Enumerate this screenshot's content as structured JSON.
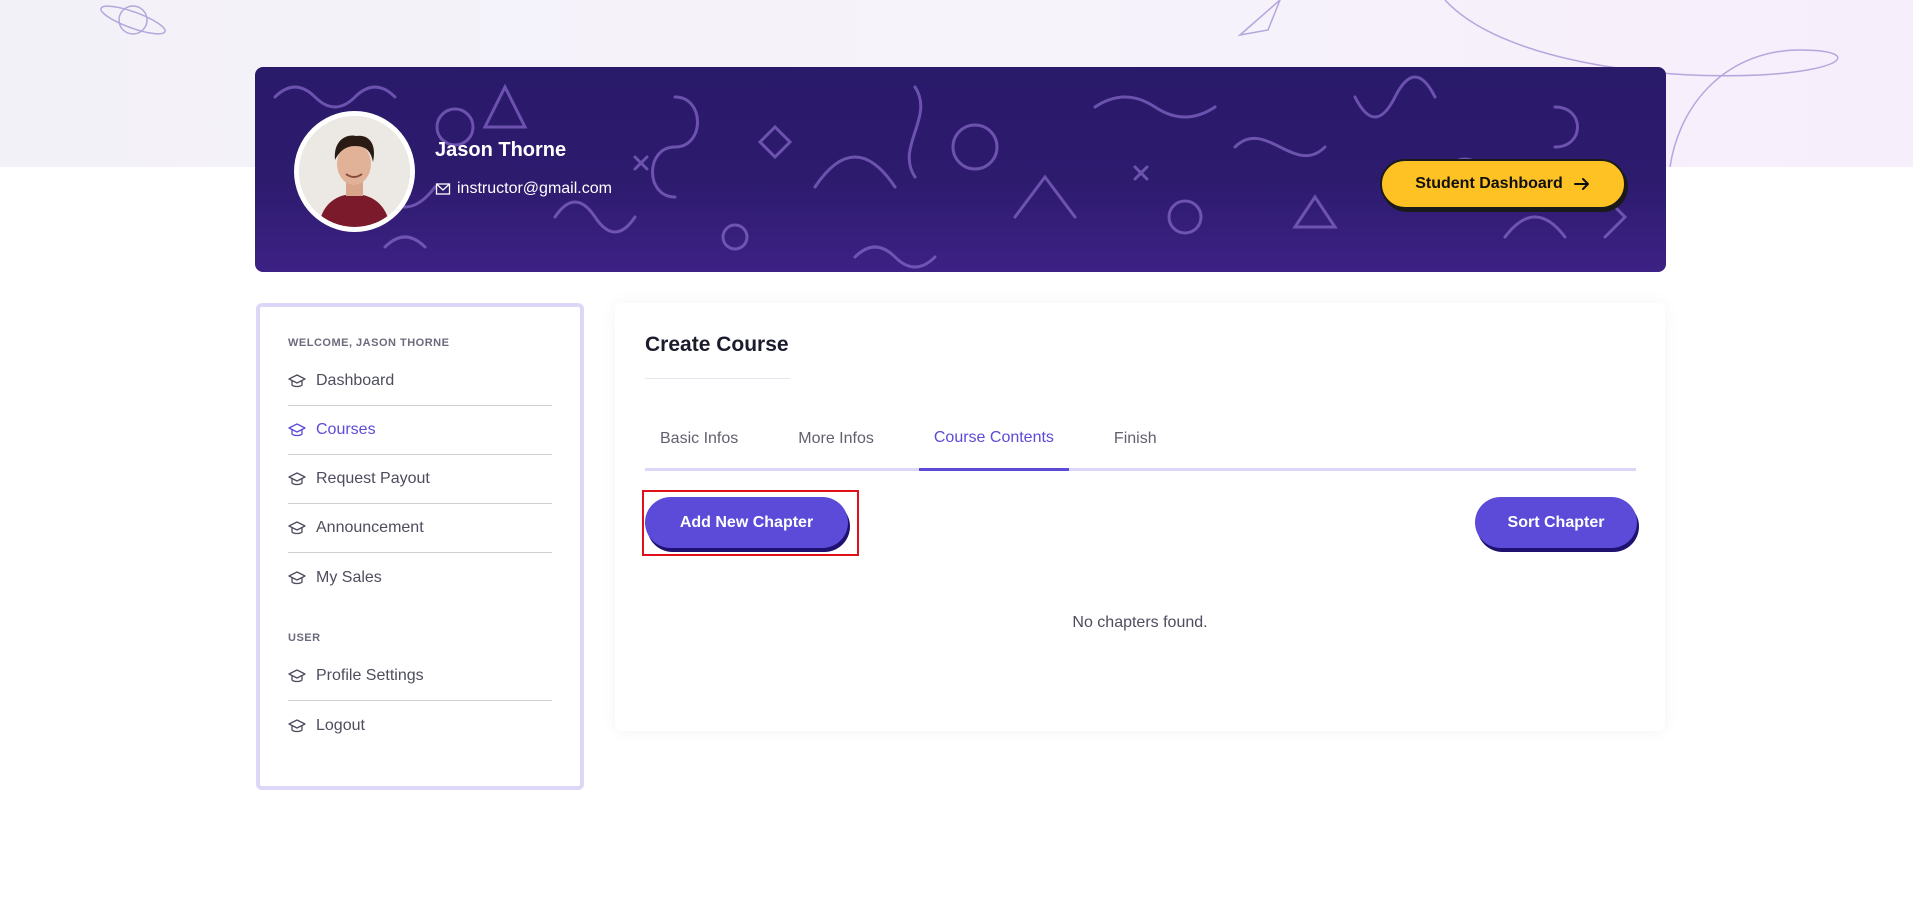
{
  "profile": {
    "name": "Jason Thorne",
    "email": "instructor@gmail.com",
    "student_dashboard_label": "Student Dashboard"
  },
  "sidebar": {
    "welcome_label": "WELCOME, JASON THORNE",
    "items": [
      {
        "label": "Dashboard"
      },
      {
        "label": "Courses"
      },
      {
        "label": "Request Payout"
      },
      {
        "label": "Announcement"
      },
      {
        "label": "My Sales"
      }
    ],
    "user_section_label": "USER",
    "user_items": [
      {
        "label": "Profile Settings"
      },
      {
        "label": "Logout"
      }
    ]
  },
  "main": {
    "title": "Create Course",
    "tabs": [
      {
        "label": "Basic Infos"
      },
      {
        "label": "More Infos"
      },
      {
        "label": "Course Contents"
      },
      {
        "label": "Finish"
      }
    ],
    "add_chapter_label": "Add New Chapter",
    "sort_chapter_label": "Sort Chapter",
    "empty_message": "No chapters found."
  },
  "colors": {
    "accent": "#5b4bd8",
    "banner": "#2d1b6e",
    "student_button": "#ffc224",
    "highlight": "#e0101a"
  }
}
